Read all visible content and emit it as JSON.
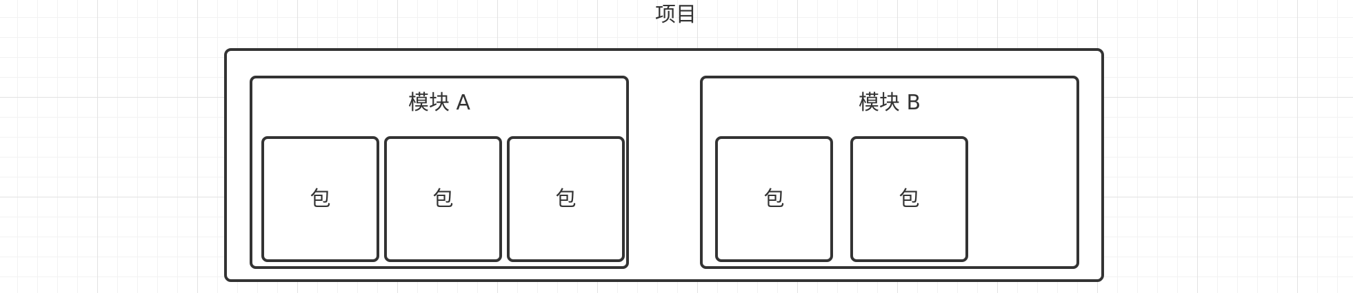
{
  "project": {
    "label": "项目"
  },
  "modules": [
    {
      "title": "模块 A",
      "packages": [
        "包",
        "包",
        "包"
      ]
    },
    {
      "title": "模块 B",
      "packages": [
        "包",
        "包"
      ]
    }
  ],
  "colors": {
    "stroke": "#333333",
    "grid_major": "#e2e2e2",
    "grid_minor": "#f2f2f2",
    "fill": "#ffffff"
  }
}
